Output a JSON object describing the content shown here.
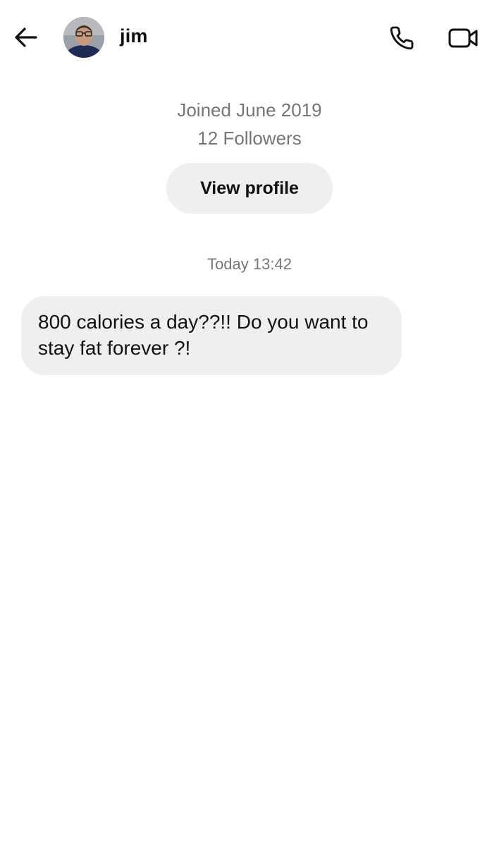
{
  "header": {
    "username": "jim",
    "icons": {
      "back": "arrow-left-icon",
      "call": "phone-icon",
      "video": "video-camera-icon"
    }
  },
  "profile": {
    "joined": "Joined June 2019",
    "followers": "12 Followers",
    "view_profile_label": "View profile"
  },
  "conversation": {
    "timestamp": "Today 13:42",
    "messages": [
      {
        "sender": "jim",
        "text": "800 calories a day??!! Do you want to stay fat forever ?!"
      }
    ]
  },
  "colors": {
    "bubble_bg": "#efefef",
    "secondary_text": "#767676",
    "primary_text": "#111111"
  }
}
